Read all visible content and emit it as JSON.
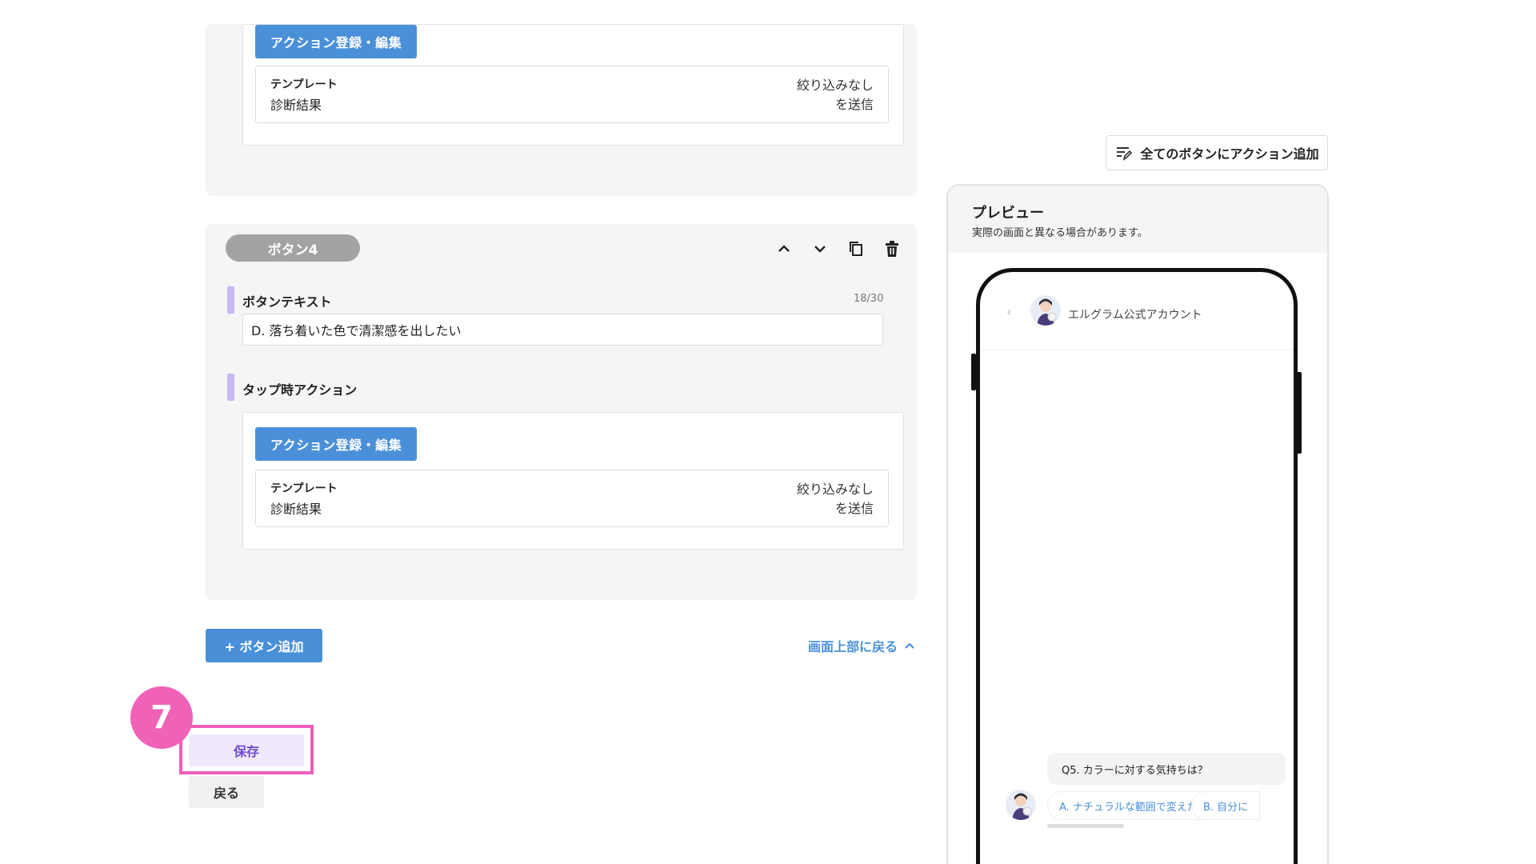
{
  "button_block_3": {
    "action_button_label": "アクション登録・編集",
    "template_label": "テンプレート",
    "template_value": "診断結果",
    "filter_text": "絞り込みなし",
    "send_text": "を送信"
  },
  "button_block_4": {
    "badge": "ボタン4",
    "button_text_label": "ボタンテキスト",
    "char_count": "18/30",
    "button_text_value": "D. 落ち着いた色で清潔感を出したい",
    "tap_action_label": "タップ時アクション",
    "action_button_label": "アクション登録・編集",
    "template_label": "テンプレート",
    "template_value": "診断結果",
    "filter_text": "絞り込みなし",
    "send_text": "を送信"
  },
  "footer": {
    "add_button_label": "+ ボタン追加",
    "back_to_top_label": "画面上部に戻る",
    "step_number": "7",
    "save_label": "保存",
    "back_label": "戻る"
  },
  "preview": {
    "add_all_action_label": "全てのボタンにアクション追加",
    "title": "プレビュー",
    "subtitle": "実際の画面と異なる場合があります。",
    "account_name": "エルグラム公式アカウント",
    "question": "Q5. カラーに対する気持ちは？",
    "quick_replies": [
      "A. ナチュラルな範囲で変えたい",
      "B. 自分に"
    ]
  },
  "colors": {
    "primary": "#4a90d9",
    "highlight": "#ee5fb8",
    "accent_bar": "#c7b8ef",
    "save_text": "#6e4bd0"
  }
}
